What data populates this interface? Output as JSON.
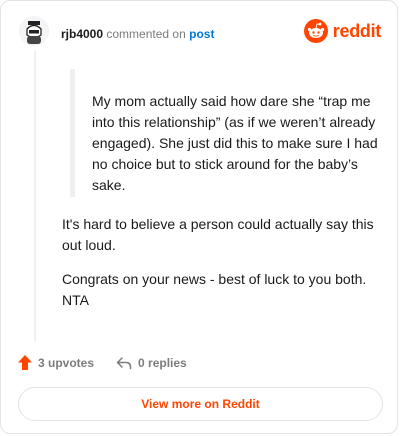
{
  "header": {
    "username": "rjb4000",
    "action": "commented on",
    "post_link": "post",
    "brand": "reddit"
  },
  "comment": {
    "quote": "My mom actually said how dare she “trap me into this relationship” (as if we weren’t already engaged). She just did this to make sure I had no choice but to stick around for the baby’s sake.",
    "paragraphs": [
      "It's hard to believe a person could actually say this out loud.",
      "Congrats on your news - best of luck to you both. NTA"
    ]
  },
  "footer": {
    "upvotes": "3 upvotes",
    "replies": "0 replies"
  },
  "cta": {
    "label": "View more on Reddit"
  },
  "colors": {
    "brand": "#ff4500",
    "link": "#0079d3",
    "muted": "#7c7c7c",
    "border": "#e1e3e5"
  },
  "icons": [
    "avatar",
    "reddit-snoo-icon",
    "upvote-arrow-icon",
    "reply-arrow-icon"
  ]
}
